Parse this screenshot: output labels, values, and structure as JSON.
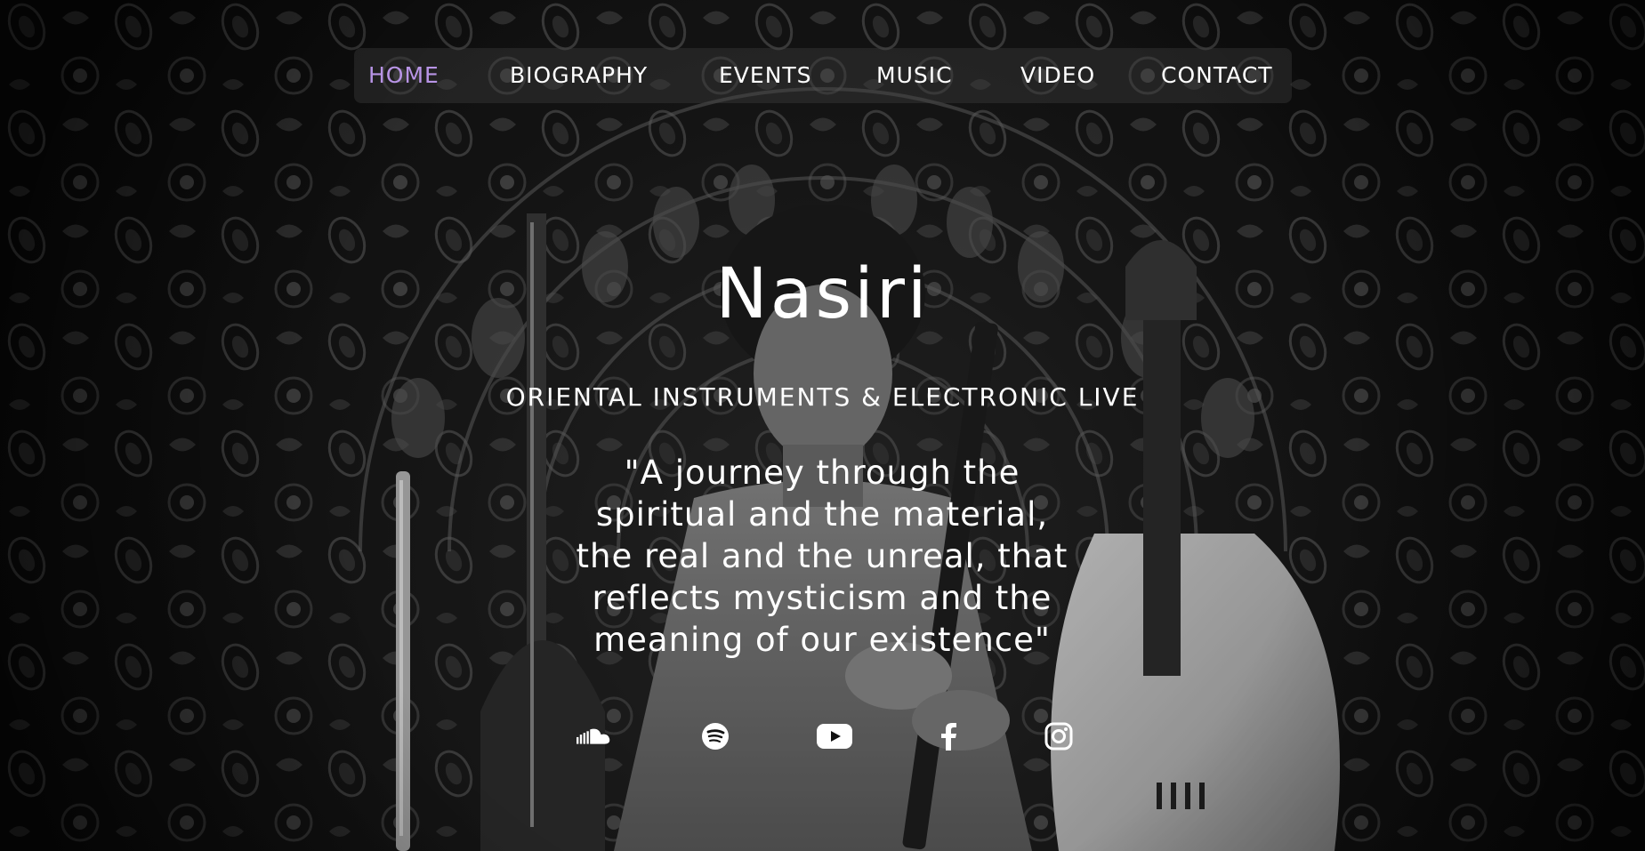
{
  "nav": {
    "items": [
      {
        "label": "HOME",
        "active": true
      },
      {
        "label": "BIOGRAPHY",
        "active": false
      },
      {
        "label": "EVENTS",
        "active": false
      },
      {
        "label": "MUSIC",
        "active": false
      },
      {
        "label": "VIDEO",
        "active": false
      },
      {
        "label": "CONTACT",
        "active": false
      }
    ],
    "active_color": "#b894e6"
  },
  "hero": {
    "title": "Nasiri",
    "subtitle": "ORIENTAL INSTRUMENTS & ELECTRONIC LIVE",
    "quote_lines": [
      "\"A journey through the",
      "spiritual and the material,",
      "the real and the unreal, that",
      "reflects mysticism and the",
      "meaning of our existence\""
    ]
  },
  "social": {
    "icons": [
      "soundcloud-icon",
      "spotify-icon",
      "youtube-icon",
      "facebook-icon",
      "instagram-icon"
    ]
  },
  "background": {
    "description_icon": "musician-with-instruments-photo"
  }
}
